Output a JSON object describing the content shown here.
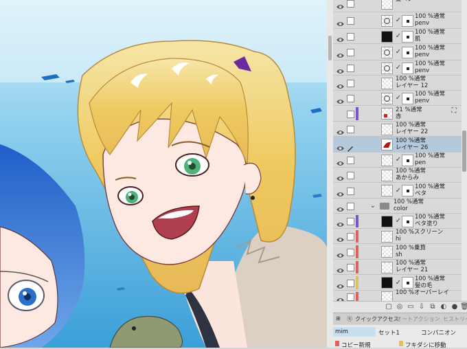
{
  "layers": [
    {
      "line1": "髪ベタ",
      "line2": ""
    },
    {
      "line1": "100 %通常",
      "line2": "penv"
    },
    {
      "line1": "100 %通常",
      "line2": "肌"
    },
    {
      "line1": "100 %通常",
      "line2": "penv"
    },
    {
      "line1": "100 %通常",
      "line2": "penv"
    },
    {
      "line1": "100 %通常",
      "line2": "レイヤー 12"
    },
    {
      "line1": "100 %通常",
      "line2": "penv"
    },
    {
      "line1": "21 %通常",
      "line2": "赤"
    },
    {
      "line1": "100 %通常",
      "line2": "レイヤー 22"
    },
    {
      "line1": "100 %通常",
      "line2": "レイヤー 26"
    },
    {
      "line1": "100 %通常",
      "line2": "pen"
    },
    {
      "line1": "100 %通常",
      "line2": "あからみ"
    },
    {
      "line1": "100 %通常",
      "line2": "ベタ"
    },
    {
      "line1": "100 %通常",
      "line2": "color"
    },
    {
      "line1": "100 %通常",
      "line2": "ベタ塗り"
    },
    {
      "line1": "100 %スクリーン",
      "line2": "hi"
    },
    {
      "line1": "100 %乗算",
      "line2": "sh"
    },
    {
      "line1": "100 %通常",
      "line2": "レイヤー 21"
    },
    {
      "line1": "100 %通常",
      "line2": "髪の毛"
    },
    {
      "line1": "100 %オーバーレイ",
      "line2": ""
    }
  ],
  "tabs": {
    "quick_access": "クイックアクセス",
    "auto_action": "オートアクション",
    "history": "ヒストリー"
  },
  "panel": {
    "field1": "mim",
    "field2": "セット1",
    "field3": "コンパニオン",
    "copy_new": "コピー新規",
    "move": "フキダシに移動"
  },
  "colors": {
    "selected_row": "#b5c9dc",
    "purple_mark": "#7a55c8",
    "red_mark": "#e06060",
    "yellow_mark": "#e0c060"
  }
}
